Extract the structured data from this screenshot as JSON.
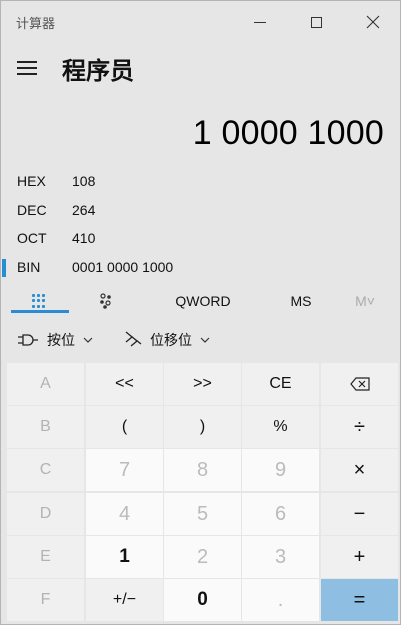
{
  "window": {
    "title": "计算器"
  },
  "header": {
    "mode_title": "程序员"
  },
  "display": {
    "result": "1 0000 1000"
  },
  "radix": [
    {
      "label": "HEX",
      "value": "108"
    },
    {
      "label": "DEC",
      "value": "264"
    },
    {
      "label": "OCT",
      "value": "410"
    },
    {
      "label": "BIN",
      "value": "0001 0000 1000"
    }
  ],
  "tabs": {
    "word_size": "QWORD",
    "ms": "MS",
    "mr": "M˅"
  },
  "dropdowns": {
    "bitwise": "按位",
    "shift": "位移位"
  },
  "keys": [
    [
      "A",
      "<<",
      ">>",
      "CE",
      "⌫"
    ],
    [
      "B",
      "(",
      ")",
      "%",
      "÷"
    ],
    [
      "C",
      "7",
      "8",
      "9",
      "×"
    ],
    [
      "D",
      "4",
      "5",
      "6",
      "−"
    ],
    [
      "E",
      "1",
      "2",
      "3",
      "+"
    ],
    [
      "F",
      "+/−",
      "0",
      ".",
      "="
    ]
  ],
  "colors": {
    "accent": "#2a8dd4",
    "equals_key": "#8ebfe2",
    "background": "#e6e6e6"
  }
}
